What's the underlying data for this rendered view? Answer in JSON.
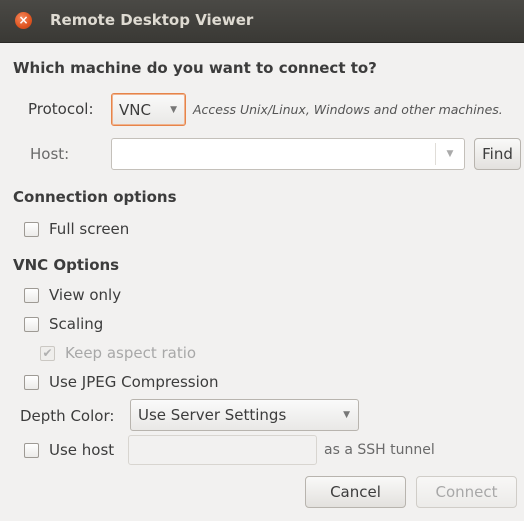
{
  "window": {
    "title": "Remote Desktop Viewer",
    "close_glyph": "×"
  },
  "main_heading": "Which machine do you want to connect to?",
  "protocol": {
    "label": "Protocol:",
    "value": "VNC",
    "description": "Access Unix/Linux, Windows and other machines."
  },
  "host": {
    "label": "Host:",
    "value": "",
    "find_label": "Find"
  },
  "connection_options": {
    "heading": "Connection options",
    "full_screen": {
      "label": "Full screen",
      "checked": false
    }
  },
  "vnc_options": {
    "heading": "VNC Options",
    "view_only": {
      "label": "View only",
      "checked": false
    },
    "scaling": {
      "label": "Scaling",
      "checked": false
    },
    "keep_aspect_ratio": {
      "label": "Keep aspect ratio",
      "checked": true,
      "disabled": true
    },
    "use_jpeg": {
      "label": "Use JPEG Compression",
      "checked": false
    },
    "depth_color": {
      "label": "Depth Color:",
      "value": "Use Server Settings"
    },
    "use_host": {
      "label": "Use host",
      "suffix": "as a SSH tunnel",
      "value": "",
      "checked": false
    }
  },
  "buttons": {
    "cancel": "Cancel",
    "connect": "Connect"
  },
  "icons": {
    "close": "close-icon",
    "dropdown": "chevron-down-icon",
    "check": "checkmark-icon"
  },
  "colors": {
    "titlebar": "#3c3b37",
    "close_button": "#df5420",
    "focus_border": "#e6844a",
    "background": "#f2f1f0"
  }
}
